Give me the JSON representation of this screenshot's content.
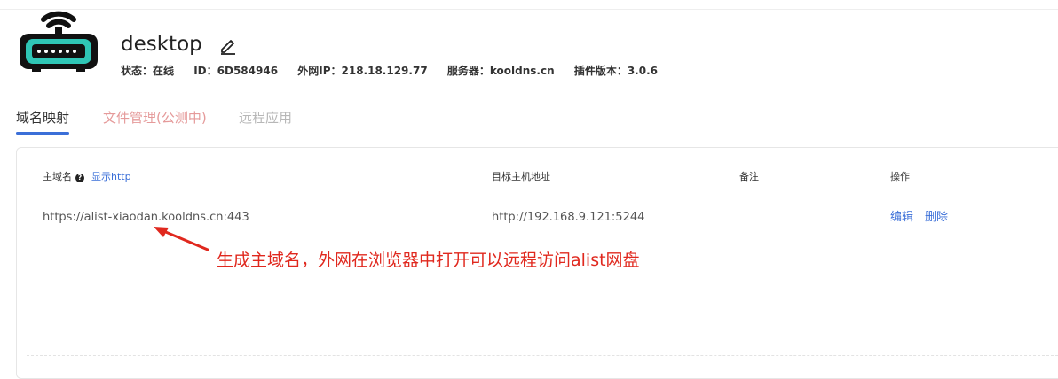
{
  "device": {
    "name": "desktop",
    "info": {
      "status": "状态：在线",
      "id": "ID：6D584946",
      "wan_ip": "外网IP：218.18.129.77",
      "server": "服务器：kooldns.cn",
      "plugin_version": "插件版本：3.0.6"
    }
  },
  "tabs": [
    {
      "label": "域名映射",
      "active": true
    },
    {
      "label": "文件管理(公测中)",
      "active": false
    },
    {
      "label": "远程应用",
      "active": false
    }
  ],
  "table": {
    "headers": {
      "host": "主域名",
      "show_http": "显示http",
      "target": "目标主机地址",
      "remark": "备注",
      "action": "操作"
    },
    "rows": [
      {
        "host": "https://alist-xiaodan.kooldns.cn:443",
        "target": "http://192.168.9.121:5244",
        "remark": "",
        "actions": {
          "edit": "编辑",
          "delete": "删除"
        }
      }
    ]
  },
  "annotation": "生成主域名，外网在浏览器中打开可以远程访问alist网盘",
  "colors": {
    "accent": "#3b6fd8",
    "annotation": "#e0281e",
    "logo_teal": "#2fc6b6",
    "tab_muted_red": "#e59a9a"
  },
  "icons": {
    "logo": "router-wifi-icon",
    "edit": "pencil-edit-icon",
    "help": "question-circle-icon"
  }
}
